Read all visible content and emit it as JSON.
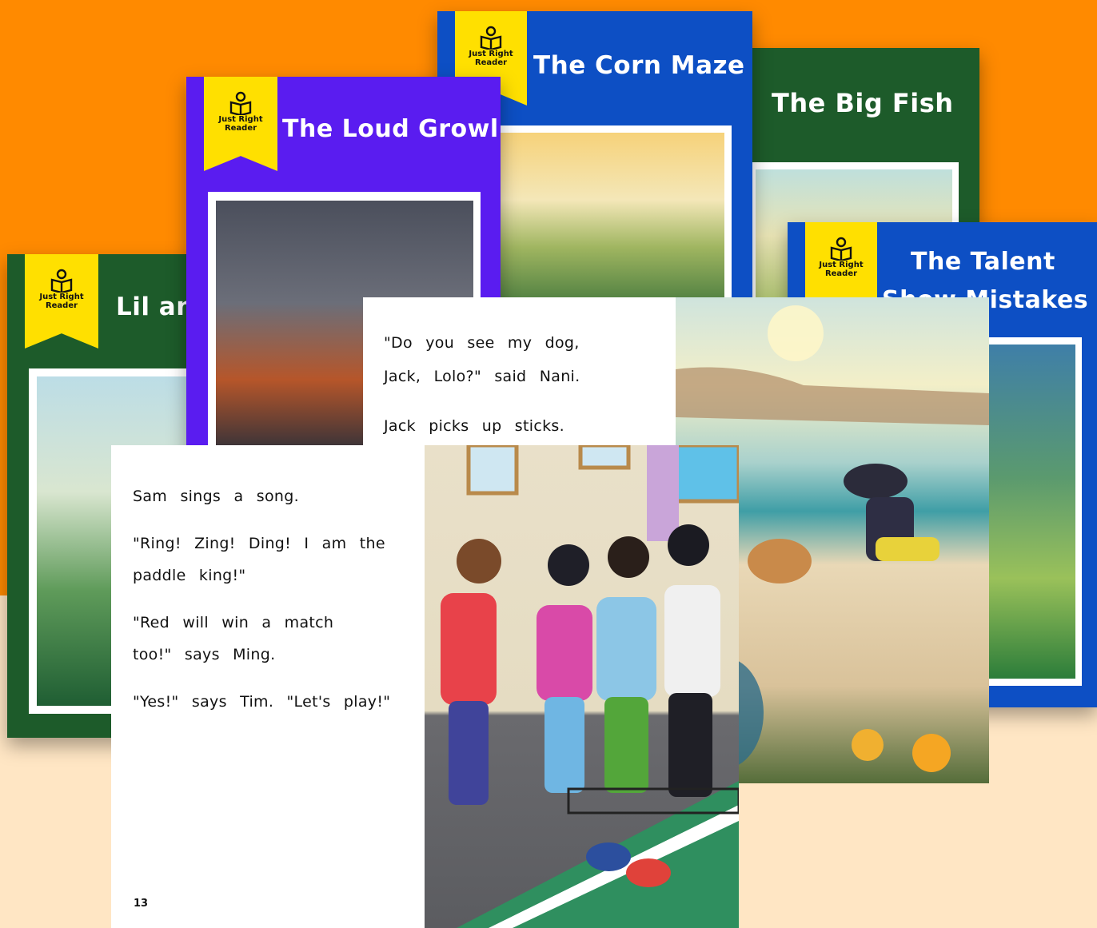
{
  "brand": {
    "line1": "Just Right",
    "line2": "Reader"
  },
  "books": {
    "corn_maze": {
      "title": "The Corn Maze",
      "color": "#0d4fc4"
    },
    "big_fish": {
      "title": "The Big Fish",
      "color": "#1d5b2a"
    },
    "loud_growl": {
      "title": "The Loud Growl",
      "color": "#5a1cf0"
    },
    "talent_show": {
      "title_line1": "The Talent",
      "title_line2": "Show Mistakes",
      "color": "#0d4fc4"
    },
    "lil": {
      "title": "Lil an",
      "color": "#1d5b2a"
    }
  },
  "beach_page": {
    "line1": "\"Do you see my dog,",
    "line2": "Jack, Lolo?\" said Nani.",
    "line3": "Jack picks up sticks."
  },
  "pingpong_page": {
    "line1": "Sam sings a song.",
    "line2": "\"Ring! Zing! Ding! I am the",
    "line3": "paddle king!\"",
    "line4": "\"Red will win a match",
    "line5": "too!\" says Ming.",
    "line6": "\"Yes!\" says Tim. \"Let's play!\"",
    "page_number": "13"
  },
  "colors": {
    "orange": "#ff8a00",
    "cream": "#ffe6c4",
    "ribbon_yellow": "#ffe000",
    "green_book": "#1d5b2a",
    "blue_book": "#0d4fc4",
    "purple_book": "#5a1cf0"
  }
}
